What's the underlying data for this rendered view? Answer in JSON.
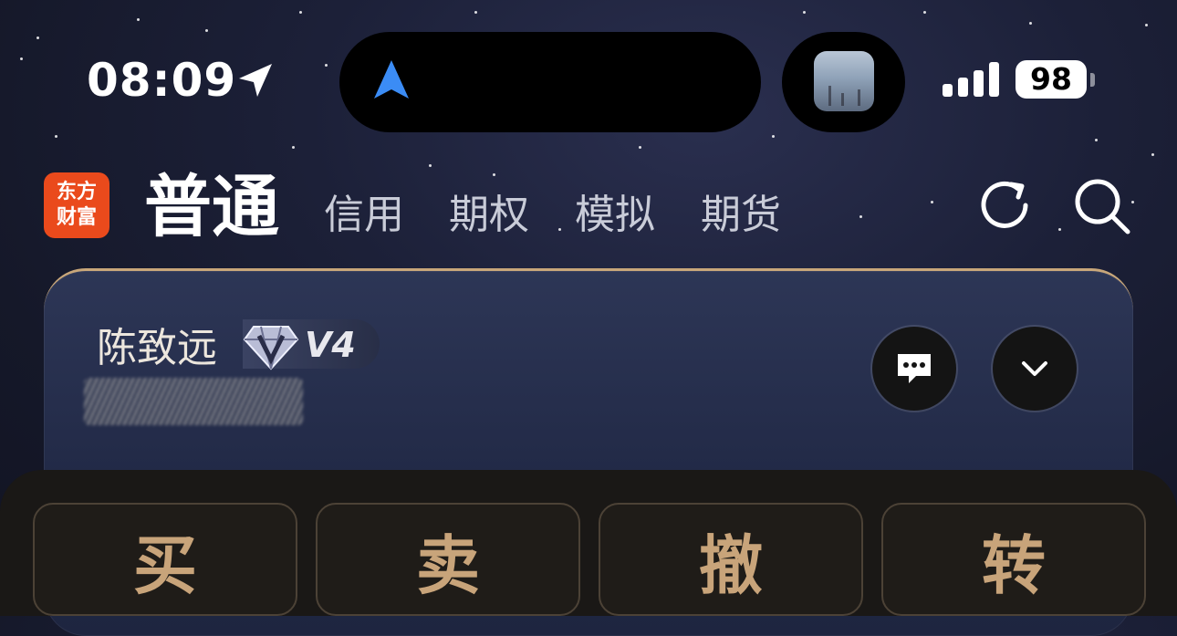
{
  "status_bar": {
    "time": "08:09",
    "battery": "98",
    "icons": [
      "location-arrow-icon",
      "navigation-arrow-icon",
      "cellular-signal-icon",
      "battery-icon"
    ]
  },
  "header": {
    "logo_line1": "东方",
    "logo_line2": "财富",
    "tabs": [
      {
        "label": "普通",
        "active": true
      },
      {
        "label": "信用",
        "active": false
      },
      {
        "label": "期权",
        "active": false
      },
      {
        "label": "模拟",
        "active": false
      },
      {
        "label": "期货",
        "active": false
      }
    ],
    "icons": [
      "refresh-icon",
      "search-icon"
    ]
  },
  "account": {
    "name": "陈致远",
    "level": "V4",
    "icons": [
      "message-icon",
      "chevron-down-icon"
    ]
  },
  "actions": [
    {
      "label": "买"
    },
    {
      "label": "卖"
    },
    {
      "label": "撤"
    },
    {
      "label": "转"
    }
  ],
  "colors": {
    "background": "#1c2038",
    "logo": "#ea4a1c",
    "action_text": "#c8a47a",
    "card_accent": "#c9a77a"
  }
}
